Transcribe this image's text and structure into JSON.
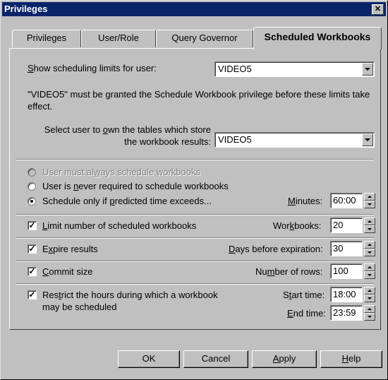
{
  "window": {
    "title": "Privileges",
    "close_glyph": "✕"
  },
  "tabs": [
    {
      "label": "Privileges",
      "active": false
    },
    {
      "label": "User/Role",
      "active": false
    },
    {
      "label": "Query Governor",
      "active": false
    },
    {
      "label": "Scheduled Workbooks",
      "active": true
    }
  ],
  "panel": {
    "show_limits_label_ul": "S",
    "show_limits_label_rest": "how scheduling limits for user:",
    "show_limits_user": "VIDEO5",
    "notice": "\"VIDEO5\" must be granted the Schedule Workbook privilege before these limits take effect.",
    "owner_label_line1_pre": "Select user to ",
    "owner_label_line1_ul": "o",
    "owner_label_line1_post": "wn the tables which store",
    "owner_label_line2": "the workbook results:",
    "owner_user": "VIDEO5",
    "radio_always_pre": "User must al",
    "radio_always_ul": "w",
    "radio_always_post": "ays schedule workbooks",
    "radio_never_pre": "User is ",
    "radio_never_ul": "n",
    "radio_never_post": "ever required to schedule workbooks",
    "radio_only_pre": "Schedule only if ",
    "radio_only_ul": "p",
    "radio_only_post": "redicted time exceeds...",
    "minutes_ul": "M",
    "minutes_rest": "inutes:",
    "minutes_value": "60:00",
    "limit_ul": "L",
    "limit_rest": "imit number of scheduled workbooks",
    "workbooks_pre": "Wor",
    "workbooks_ul": "k",
    "workbooks_post": "books:",
    "workbooks_value": "20",
    "expire_pre": "E",
    "expire_ul": "x",
    "expire_post": "pire results",
    "days_ul": "D",
    "days_rest": "ays before expiration:",
    "days_value": "30",
    "commit_ul": "C",
    "commit_rest": "ommit size",
    "rows_pre": "Nu",
    "rows_ul": "m",
    "rows_post": "ber of rows:",
    "rows_value": "100",
    "restrict_pre": "Res",
    "restrict_ul": "t",
    "restrict_post": "rict the hours during which a workbook",
    "restrict_line2": "may be scheduled",
    "start_pre": "S",
    "start_ul": "t",
    "start_post": "art time:",
    "start_value": "18:00",
    "end_ul": "E",
    "end_rest": "nd time:",
    "end_value": "23:59",
    "check_glyph": "✓"
  },
  "buttons": {
    "ok": "OK",
    "cancel": "Cancel",
    "apply_ul": "A",
    "apply_rest": "pply",
    "help_ul": "H",
    "help_rest": "elp"
  }
}
